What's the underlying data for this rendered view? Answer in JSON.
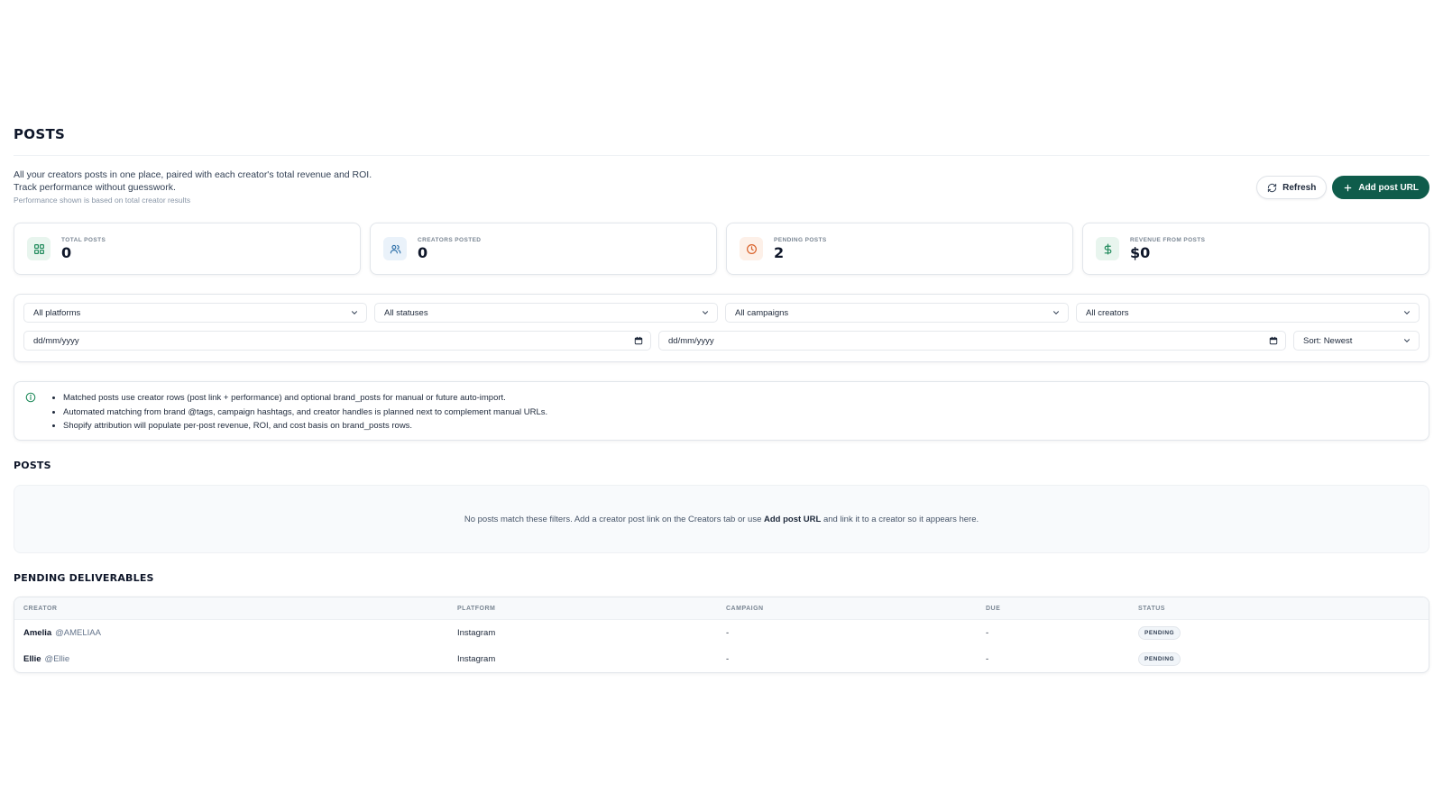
{
  "header": {
    "title": "POSTS",
    "description": "All your creators posts in one place, paired with each creator's total revenue and ROI. Track performance without guesswork.",
    "note": "Performance shown is based on total creator results"
  },
  "actions": {
    "refresh_label": "Refresh",
    "add_post_label": "Add post URL"
  },
  "stats": [
    {
      "label": "TOTAL POSTS",
      "value": "0",
      "icon": "grid-icon",
      "color": "#1f8a5b"
    },
    {
      "label": "CREATORS POSTED",
      "value": "0",
      "icon": "users-icon",
      "color": "#2c6fa8"
    },
    {
      "label": "PENDING POSTS",
      "value": "2",
      "icon": "clock-icon",
      "color": "#d9622b"
    },
    {
      "label": "REVENUE FROM POSTS",
      "value": "$0",
      "icon": "dollar-icon",
      "color": "#1f8a5b"
    }
  ],
  "filters": {
    "platform": "All platforms",
    "status": "All statuses",
    "campaign": "All campaigns",
    "creator": "All creators",
    "date_from_placeholder": "dd/mm/yyyy",
    "date_to_placeholder": "dd/mm/yyyy",
    "sort": "Sort: Newest"
  },
  "info": {
    "items": [
      "Matched posts use creator rows (post link + performance) and optional brand_posts for manual or future auto-import.",
      "Automated matching from brand @tags, campaign hashtags, and creator handles is planned next to complement manual URLs.",
      "Shopify attribution will populate per-post revenue, ROI, and cost basis on brand_posts rows."
    ]
  },
  "posts_section": {
    "title": "POSTS",
    "empty_before": "No posts match these filters. Add a creator post link on the Creators tab or use ",
    "empty_link": "Add post URL",
    "empty_after": " and link it to a creator so it appears here."
  },
  "pending": {
    "title": "PENDING DELIVERABLES",
    "columns": [
      "CREATOR",
      "PLATFORM",
      "CAMPAIGN",
      "DUE",
      "STATUS"
    ],
    "rows": [
      {
        "name": "Amelia",
        "handle": "@AMELIAA",
        "platform": "Instagram",
        "campaign": "-",
        "due": "-",
        "status": "PENDING"
      },
      {
        "name": "Ellie",
        "handle": "@Ellie",
        "platform": "Instagram",
        "campaign": "-",
        "due": "-",
        "status": "PENDING"
      }
    ]
  },
  "colors": {
    "primary": "#0f5c4b",
    "border": "#e2e6eb"
  }
}
